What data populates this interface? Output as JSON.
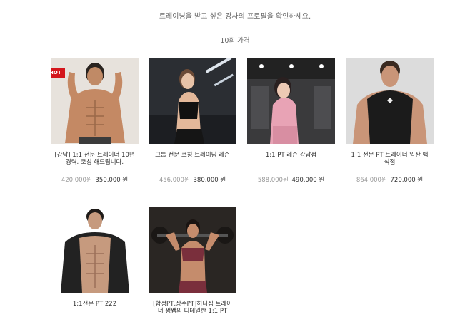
{
  "header": {
    "subtitle": "트레이닝을 받고 싶은 강사의 프로필을 확인하세요.",
    "section_label": "10회 가격"
  },
  "products": [
    {
      "badge": "HOT",
      "title": "[강남] 1:1 전문 트레이너 10년 경력. 코칭 해드립니다.",
      "old_price": "420,000원",
      "price": "350,000 원"
    },
    {
      "badge": "",
      "title": "그룹 전문 코칭 트레이닝 레슨",
      "old_price": "456,000원",
      "price": "380,000 원"
    },
    {
      "badge": "",
      "title": "1:1 PT 레슨 강남점",
      "old_price": "588,000원",
      "price": "490,000 원"
    },
    {
      "badge": "",
      "title": "1:1 전문 PT 트레이너 일산 백석점",
      "old_price": "864,000원",
      "price": "720,000 원"
    },
    {
      "badge": "",
      "title": "1:1전문 PT 222",
      "old_price": "",
      "price": ""
    },
    {
      "badge": "",
      "title": "[합정PT,상수PT]허니짐 트레이너 쩡쌤의 디테일한 1:1 PT",
      "old_price": "",
      "price": ""
    }
  ]
}
